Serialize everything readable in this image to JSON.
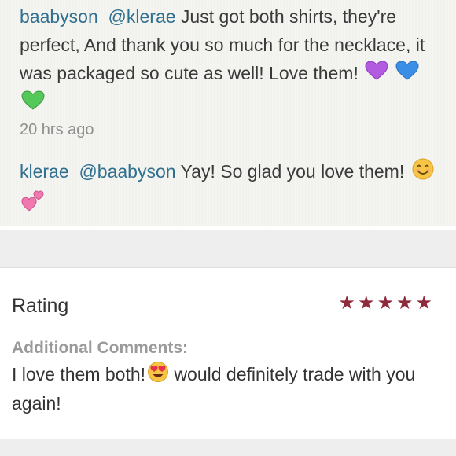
{
  "comments": [
    {
      "user": "baabyson",
      "mention": "@klerae",
      "text": "Just got both shirts, they're perfect, And thank you so much for the necklace, it was packaged so cute as well! Love them!",
      "emoji": [
        "purple-heart-icon",
        "blue-heart-icon",
        "green-heart-icon"
      ],
      "timestamp": "20 hrs ago"
    },
    {
      "user": "klerae",
      "mention": "@baabyson",
      "text": "Yay! So glad you love them!",
      "emoji": [
        "smiling-face-icon",
        "two-hearts-icon"
      ]
    }
  ],
  "review": {
    "rating_label": "Rating",
    "stars": 5,
    "star_color": "#8e2a3b",
    "additional_label": "Additional Comments:",
    "text_before_emoji": "I love them both!",
    "emoji": "heart-eyes-icon",
    "text_after_emoji": "would definitely trade with you again!"
  },
  "colors": {
    "username": "#2f6f8f",
    "body_text": "#3a3a3a",
    "muted": "#8e8e8e"
  }
}
